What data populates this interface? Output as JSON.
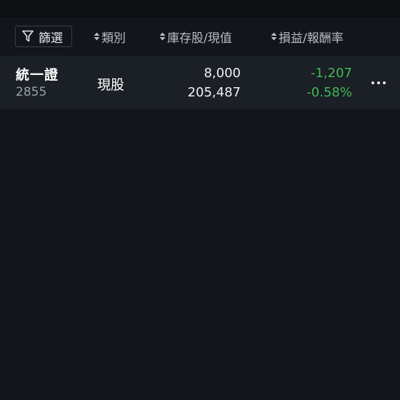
{
  "header": {
    "filter_label": "篩選",
    "columns": [
      {
        "label": "類別"
      },
      {
        "label": "庫存股/現值"
      },
      {
        "label": "損益/報酬率"
      }
    ]
  },
  "holdings": [
    {
      "name": "統一證",
      "code": "2855",
      "type": "現股",
      "quantity": "8,000",
      "market_value": "205,487",
      "profit_loss": "-1,207",
      "return_rate": "-0.58%"
    }
  ],
  "colors": {
    "background": "#12151b",
    "row_background": "#1b1f26",
    "loss_color": "#3fb950"
  }
}
